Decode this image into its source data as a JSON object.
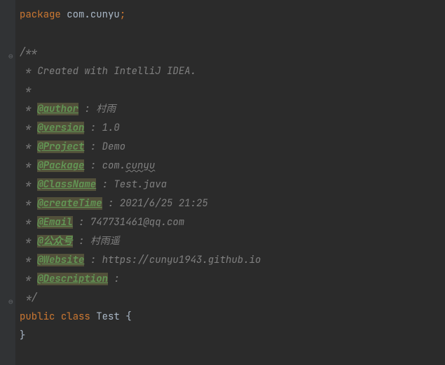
{
  "package_keyword": "package",
  "package_name": "com.cunyu",
  "semicolon": ";",
  "javadoc": {
    "open": "/**",
    "line_created": " * Created with IntelliJ IDEA.",
    "star": " *",
    "tags": [
      {
        "prefix": " * ",
        "tag": "@author",
        "value": " : 村雨"
      },
      {
        "prefix": " * ",
        "tag": "@version",
        "value": " : 1.0"
      },
      {
        "prefix": " * ",
        "tag": "@Project",
        "value": " : Demo"
      },
      {
        "prefix": " * ",
        "tag": "@Package",
        "value_before": " : com.",
        "value_wavy": "cunyu"
      },
      {
        "prefix": " * ",
        "tag": "@ClassName",
        "value": " : Test.java"
      },
      {
        "prefix": " * ",
        "tag": "@createTime",
        "value": " : 2021/6/25 21:25"
      },
      {
        "prefix": " * ",
        "tag": "@Email",
        "value": " : 747731461@qq.com"
      },
      {
        "prefix": " * ",
        "tag": "@公众号",
        "value": " : 村雨遥"
      },
      {
        "prefix": " * ",
        "tag": "@Website",
        "value": " : https://cunyu1943.github.io"
      },
      {
        "prefix": " * ",
        "tag": "@Description",
        "value": " :"
      }
    ],
    "close": " */"
  },
  "class_decl": {
    "public": "public",
    "class": "class",
    "name": "Test",
    "open_brace": "{",
    "close_brace": "}"
  },
  "fold_markers": {
    "open": "⊖",
    "close": "⊖"
  }
}
